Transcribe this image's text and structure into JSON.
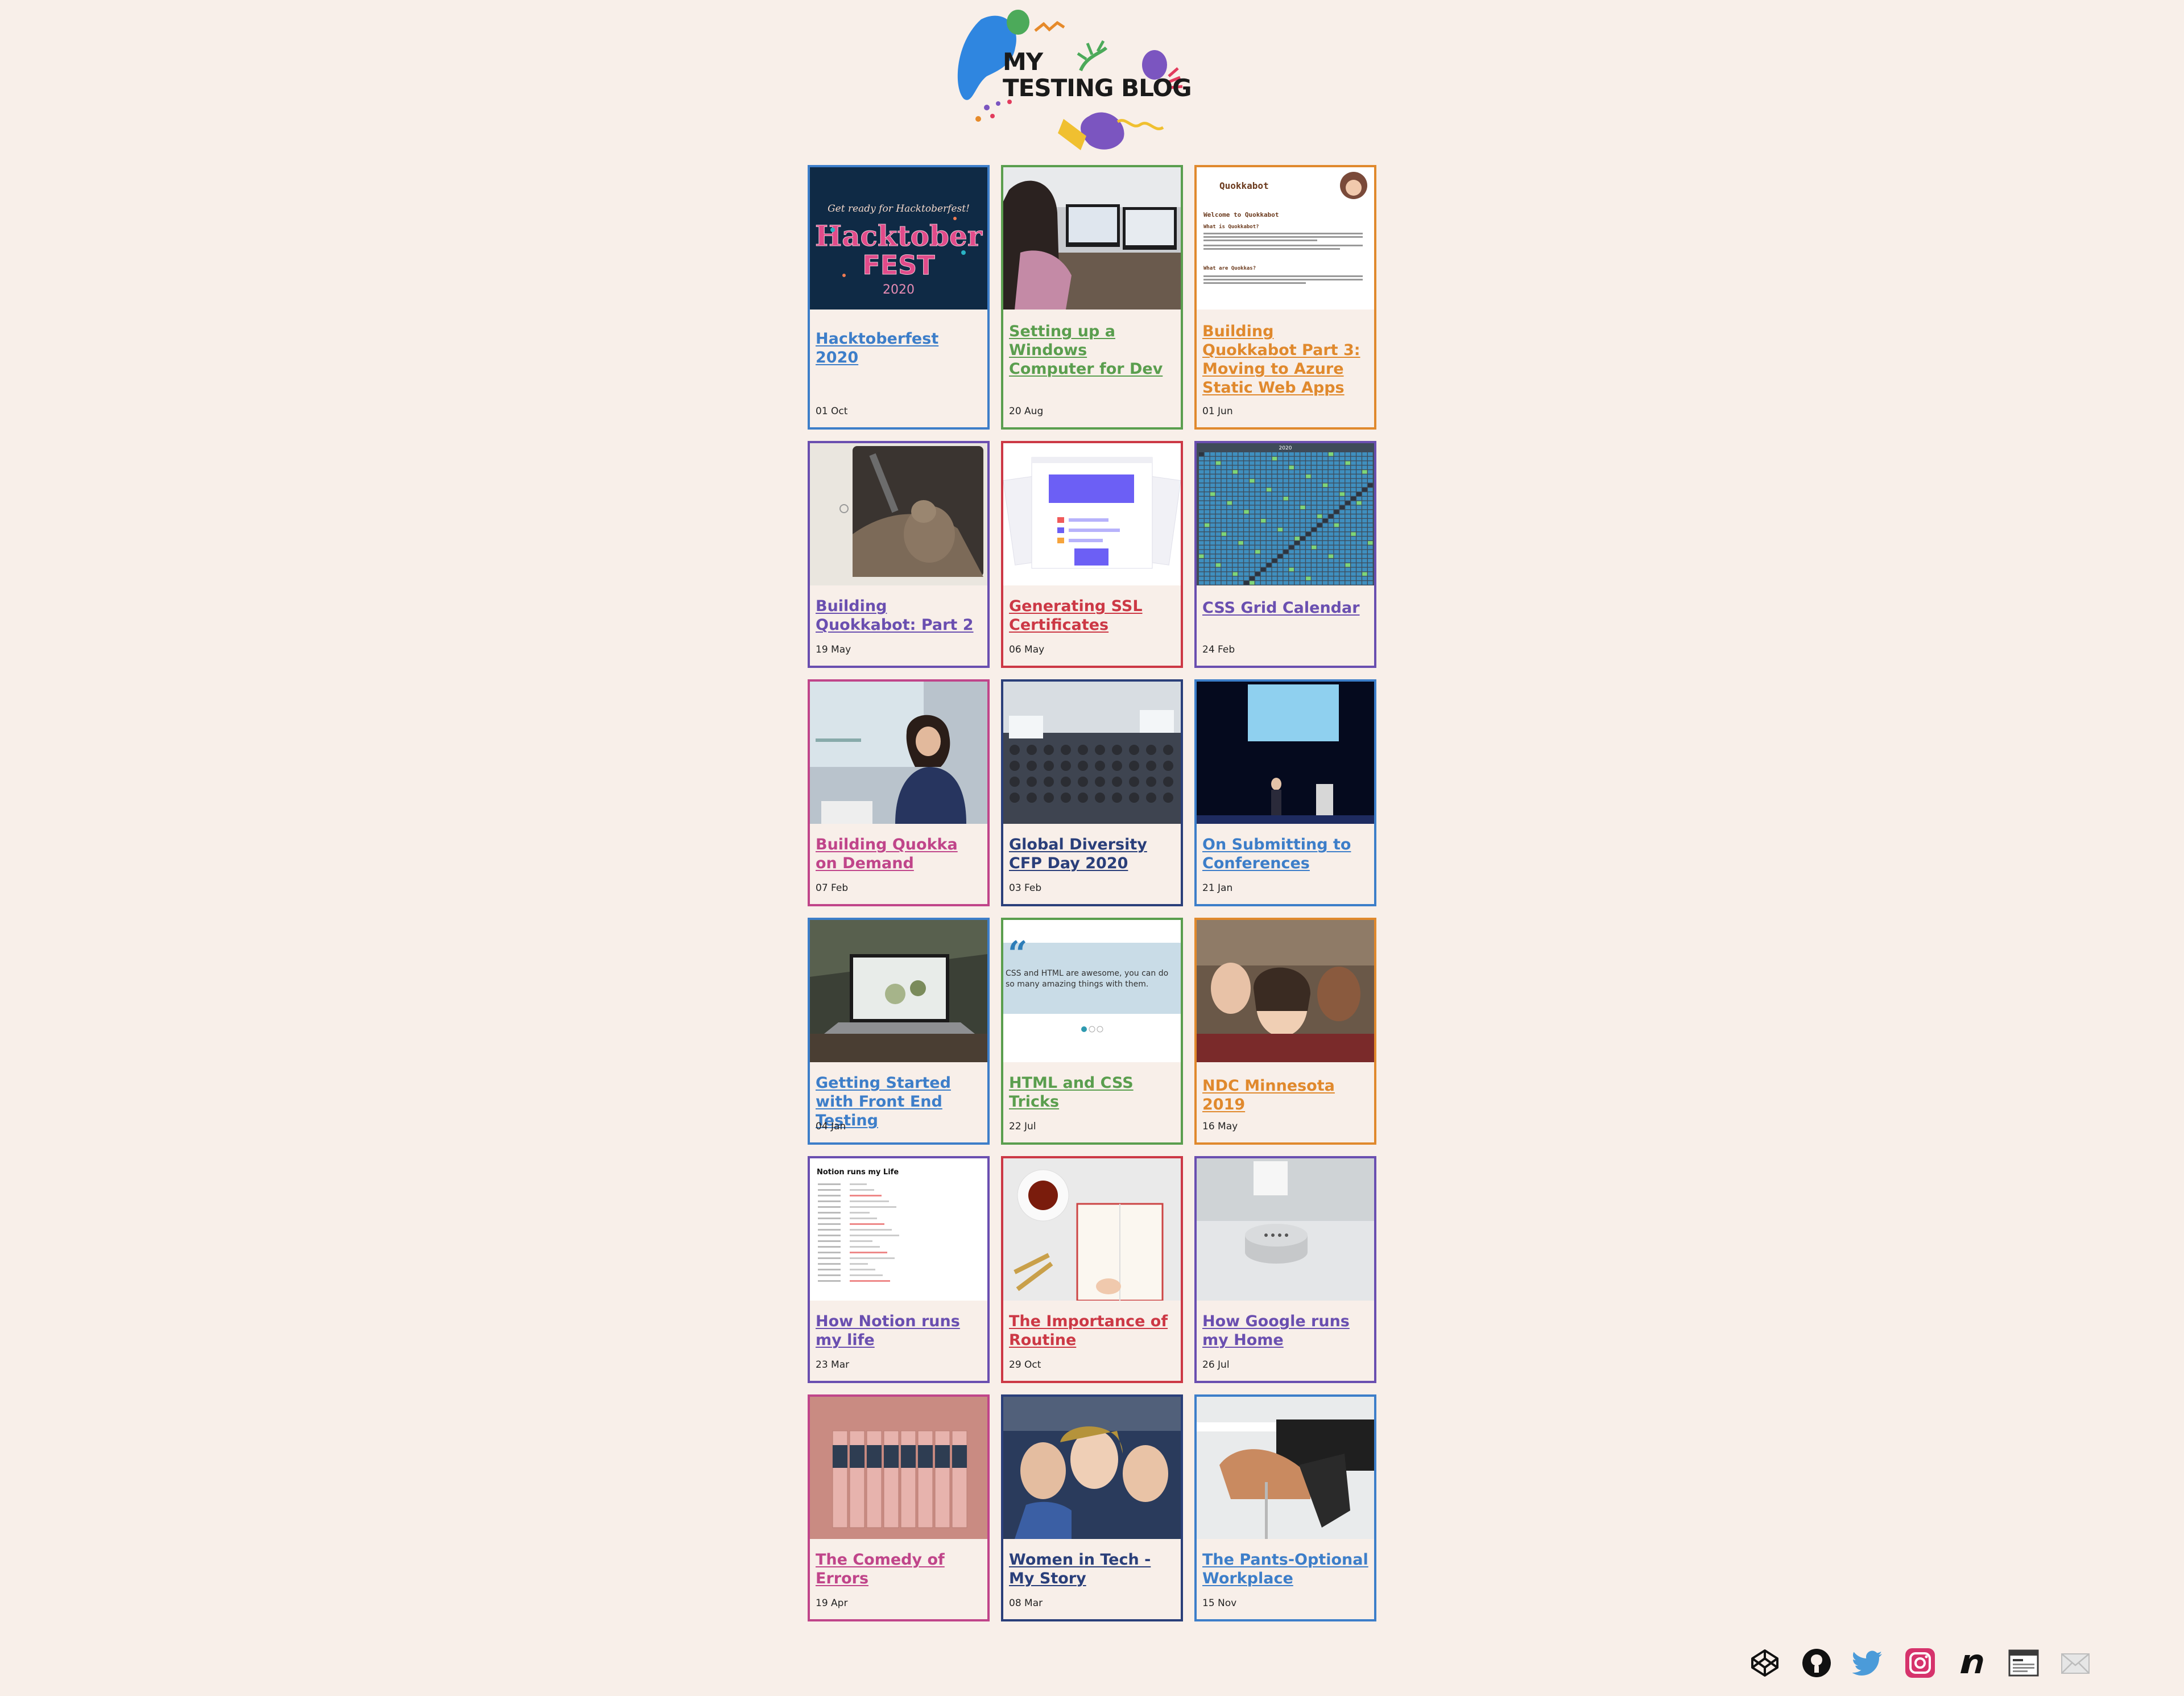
{
  "header": {
    "logo_line1": "MY",
    "logo_line2": "TESTING BLOG"
  },
  "posts": [
    {
      "title": "Hacktoberfest 2020",
      "date": "01 Oct",
      "color": "#3d7ec9",
      "thumb": "hacktoberfest",
      "thumb_text_top": "Get ready for Hacktoberfest!",
      "thumb_text_main": "Hacktober",
      "thumb_text_sub": "FEST",
      "thumb_text_year": "2020"
    },
    {
      "title": "Setting up a Windows Computer for Dev",
      "date": "20 Aug",
      "color": "#5a9e4e",
      "thumb": "desk-photo"
    },
    {
      "title": "Building Quokkabot Part 3: Moving to Azure Static Web Apps",
      "date": "01 Jun",
      "color": "#e0892d",
      "thumb": "quokkabot",
      "thumb_text_title": "Quokkabot",
      "thumb_text_welcome": "Welcome to Quokkabot",
      "thumb_text_q1": "What is Quokkabot?",
      "thumb_text_q2": "What are Quokkas?"
    },
    {
      "title": "Building Quokkabot: Part 2",
      "date": "19 May",
      "color": "#6a4fb0",
      "thumb": "quokka-photo"
    },
    {
      "title": "Generating SSL Certificates",
      "date": "06 May",
      "color": "#cc3845",
      "thumb": "ssl-illustration"
    },
    {
      "title": "CSS Grid Calendar",
      "date": "24 Feb",
      "color": "#6a4fb0",
      "thumb": "calendar",
      "thumb_text_year": "2020"
    },
    {
      "title": "Building Quokka on Demand",
      "date": "07 Feb",
      "color": "#c0458a",
      "thumb": "speaker-photo"
    },
    {
      "title": "Global Diversity CFP Day 2020",
      "date": "03 Feb",
      "color": "#2a3f7a",
      "thumb": "room-photo"
    },
    {
      "title": "On Submitting to Conferences",
      "date": "21 Jan",
      "color": "#3d7ec9",
      "thumb": "stage-photo"
    },
    {
      "title": "Getting Started with Front End Testing",
      "date": "04 Jan",
      "color": "#3d7ec9",
      "thumb": "laptop-photo"
    },
    {
      "title": "HTML and CSS Tricks",
      "date": "22 Jul",
      "color": "#5a9e4e",
      "thumb": "quote-slider",
      "thumb_text_quote": "CSS and HTML are awesome, you can do so many amazing things with them."
    },
    {
      "title": "NDC Minnesota 2019",
      "date": "16 May",
      "color": "#e0892d",
      "thumb": "selfie-photo"
    },
    {
      "title": "How Notion runs my life",
      "date": "23 Mar",
      "color": "#6a4fb0",
      "thumb": "notion-page",
      "thumb_text_title": "Notion runs my Life"
    },
    {
      "title": "The Importance of Routine",
      "date": "29 Oct",
      "color": "#cc3845",
      "thumb": "notebook-photo"
    },
    {
      "title": "How Google runs my Home",
      "date": "26 Jul",
      "color": "#6a4fb0",
      "thumb": "speaker-device-photo"
    },
    {
      "title": "The Comedy of Errors",
      "date": "19 Apr",
      "color": "#c0458a",
      "thumb": "books-photo"
    },
    {
      "title": "Women in Tech - My Story",
      "date": "08 Mar",
      "color": "#2a3f7a",
      "thumb": "group-photo"
    },
    {
      "title": "The Pants-Optional Workplace",
      "date": "15 Nov",
      "color": "#3d7ec9",
      "thumb": "chair-photo"
    }
  ],
  "social": [
    {
      "name": "codepen-icon",
      "color": "#111111"
    },
    {
      "name": "github-icon",
      "color": "#111111"
    },
    {
      "name": "twitter-icon",
      "color": "#4b9bd9"
    },
    {
      "name": "instagram-icon",
      "color": "#d6336c"
    },
    {
      "name": "notist-icon",
      "color": "#111111"
    },
    {
      "name": "browser-icon",
      "color": "#3a3a3a"
    },
    {
      "name": "mail-icon",
      "color": "#b8b8b8"
    }
  ]
}
